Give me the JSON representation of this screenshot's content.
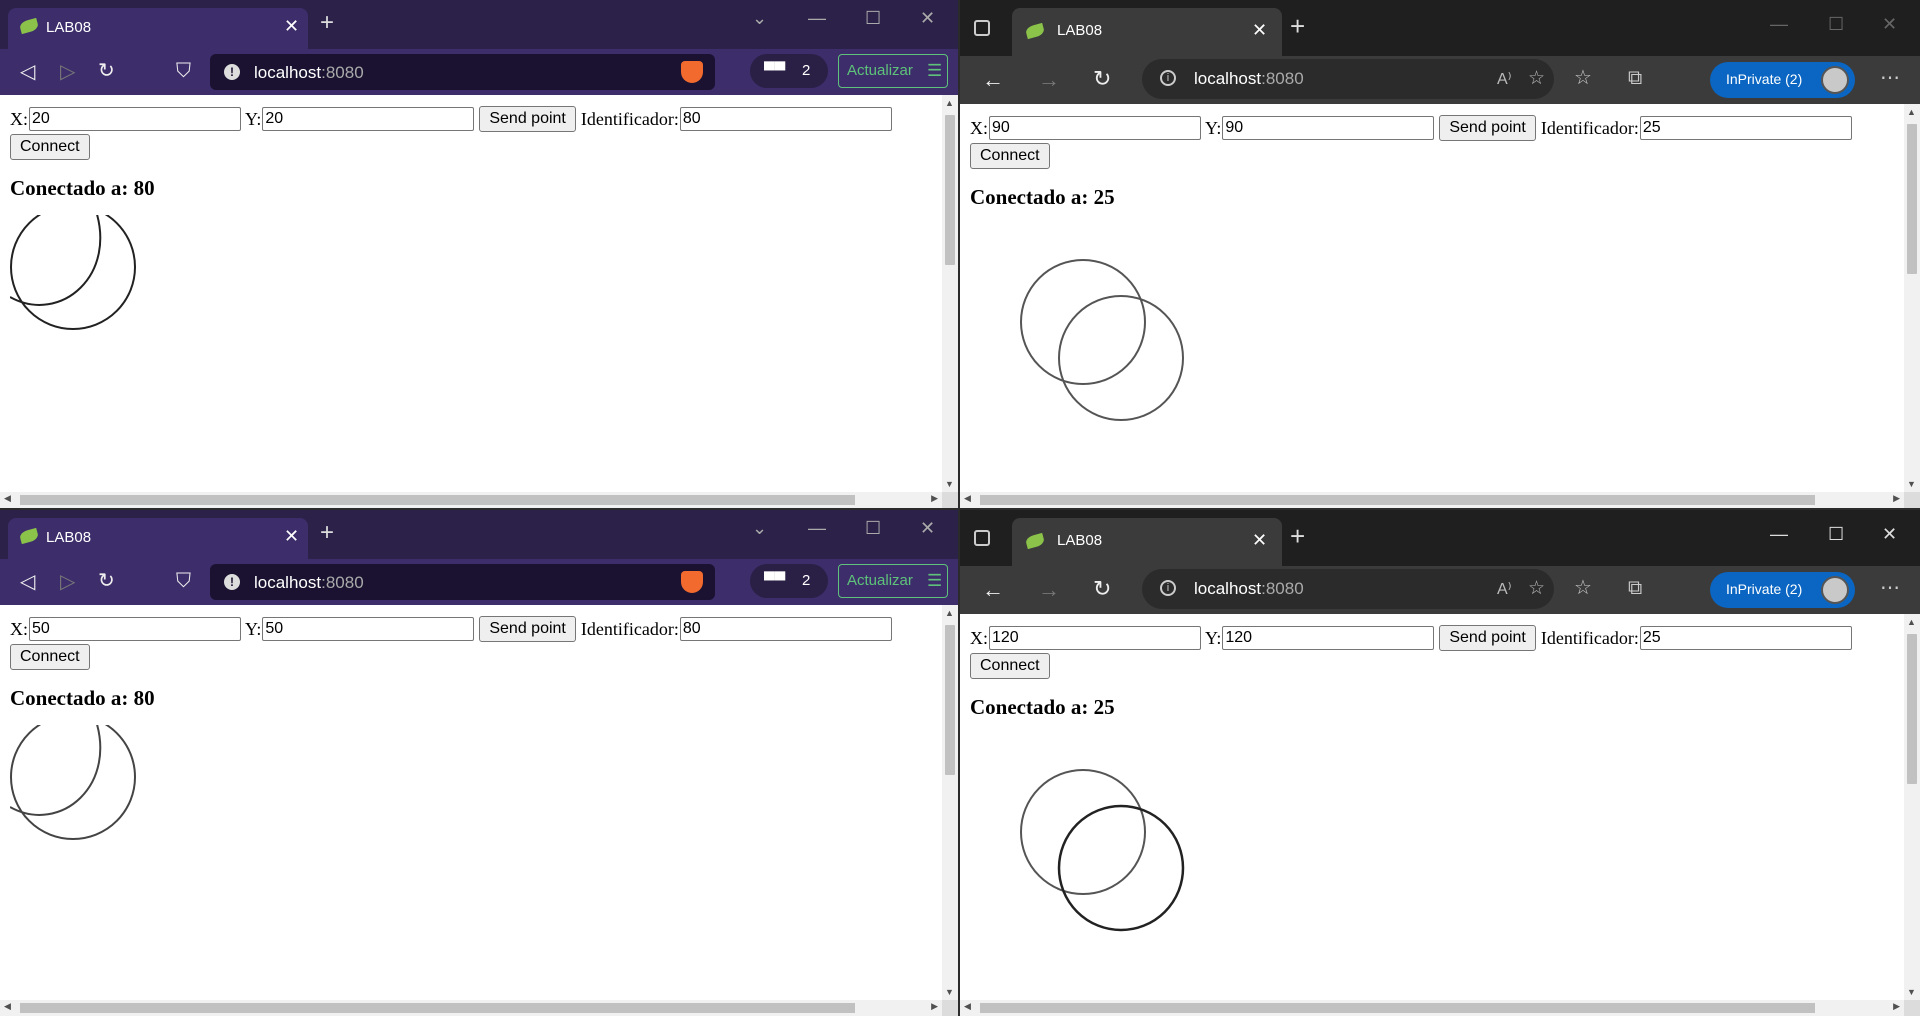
{
  "windows": {
    "top_left": {
      "browser": "brave",
      "tab_title": "LAB08",
      "url_host": "localhost",
      "url_port": ":8080",
      "wallet_count": "2",
      "update_label": "Actualizar",
      "x_label": "X:",
      "x_value": "20",
      "y_label": "Y:",
      "y_value": "20",
      "send_label": "Send point",
      "id_label": "Identificador:",
      "id_value": "80",
      "connect_label": "Connect",
      "status": "Conectado a: 80"
    },
    "top_right": {
      "browser": "edge",
      "tab_title": "LAB08",
      "url_host": "localhost",
      "url_port": ":8080",
      "read_aloud": "A⁾",
      "inprivate_label": "InPrivate (2)",
      "x_label": "X:",
      "x_value": "90",
      "y_label": "Y:",
      "y_value": "90",
      "send_label": "Send point",
      "id_label": "Identificador:",
      "id_value": "25",
      "connect_label": "Connect",
      "status": "Conectado a: 25"
    },
    "bottom_left": {
      "browser": "brave",
      "tab_title": "LAB08",
      "url_host": "localhost",
      "url_port": ":8080",
      "wallet_count": "2",
      "update_label": "Actualizar",
      "x_label": "X:",
      "x_value": "50",
      "y_label": "Y:",
      "y_value": "50",
      "send_label": "Send point",
      "id_label": "Identificador:",
      "id_value": "80",
      "connect_label": "Connect",
      "status": "Conectado a: 80"
    },
    "bottom_right": {
      "browser": "edge",
      "tab_title": "LAB08",
      "url_host": "localhost",
      "url_port": ":8080",
      "read_aloud": "A⁾",
      "inprivate_label": "InPrivate (2)",
      "x_label": "X:",
      "x_value": "120",
      "y_label": "Y:",
      "y_value": "120",
      "send_label": "Send point",
      "id_label": "Identificador:",
      "id_value": "25",
      "connect_label": "Connect",
      "status": "Conectado a: 25"
    }
  },
  "icons": {
    "favicon": "spring-leaf-icon",
    "back": "back-arrow-icon",
    "forward": "forward-arrow-icon",
    "reload": "reload-icon",
    "bookmark": "bookmark-icon",
    "site_info": "site-info-icon",
    "brave_shield": "brave-lion-icon",
    "wallet": "sunglasses-icon",
    "more": "ellipsis-icon"
  },
  "colors": {
    "brave_tabstrip": "#2c2149",
    "brave_toolbar": "#3d2d6b",
    "edge_tabstrip": "#1f1f1f",
    "edge_toolbar": "#3b3b3b",
    "inprivate_blue": "#0a66c2",
    "update_green": "#5ec27a"
  }
}
